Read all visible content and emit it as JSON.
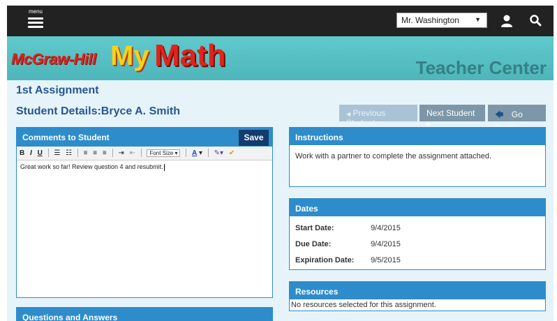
{
  "topbar": {
    "menu_label": "menu",
    "user_selected": "Mr. Washington"
  },
  "banner": {
    "logo_mcgraw": "McGraw-Hill",
    "logo_my": "My",
    "logo_math": "Math",
    "section_title": "Teacher Center"
  },
  "page": {
    "assignment_title": "1st Assignment",
    "student_details": "Student Details:Bryce A. Smith"
  },
  "nav": {
    "previous_label": "Previous Student",
    "next_label": "Next Student",
    "back_label": "Go Back"
  },
  "comments": {
    "title": "Comments to Student",
    "save_label": "Save",
    "font_size_label": "Font Size",
    "text": "Great work so far! Review question 4 and resubmit."
  },
  "questions": {
    "title": "Questions and Answers"
  },
  "instructions": {
    "title": "Instructions",
    "text": "Work with a partner to complete the assignment attached."
  },
  "dates": {
    "title": "Dates",
    "rows": [
      {
        "label": "Start Date:",
        "value": "9/4/2015"
      },
      {
        "label": "Due Date:",
        "value": "9/4/2015"
      },
      {
        "label": "Expiration Date:",
        "value": "9/5/2015"
      }
    ]
  },
  "resources": {
    "title": "Resources",
    "text": "No resources selected for this assignment."
  },
  "colors": {
    "panel_header": "#2e8ccb",
    "title_blue": "#27568f",
    "banner_teal": "#5fc9cc",
    "save_button": "#123c6e"
  }
}
